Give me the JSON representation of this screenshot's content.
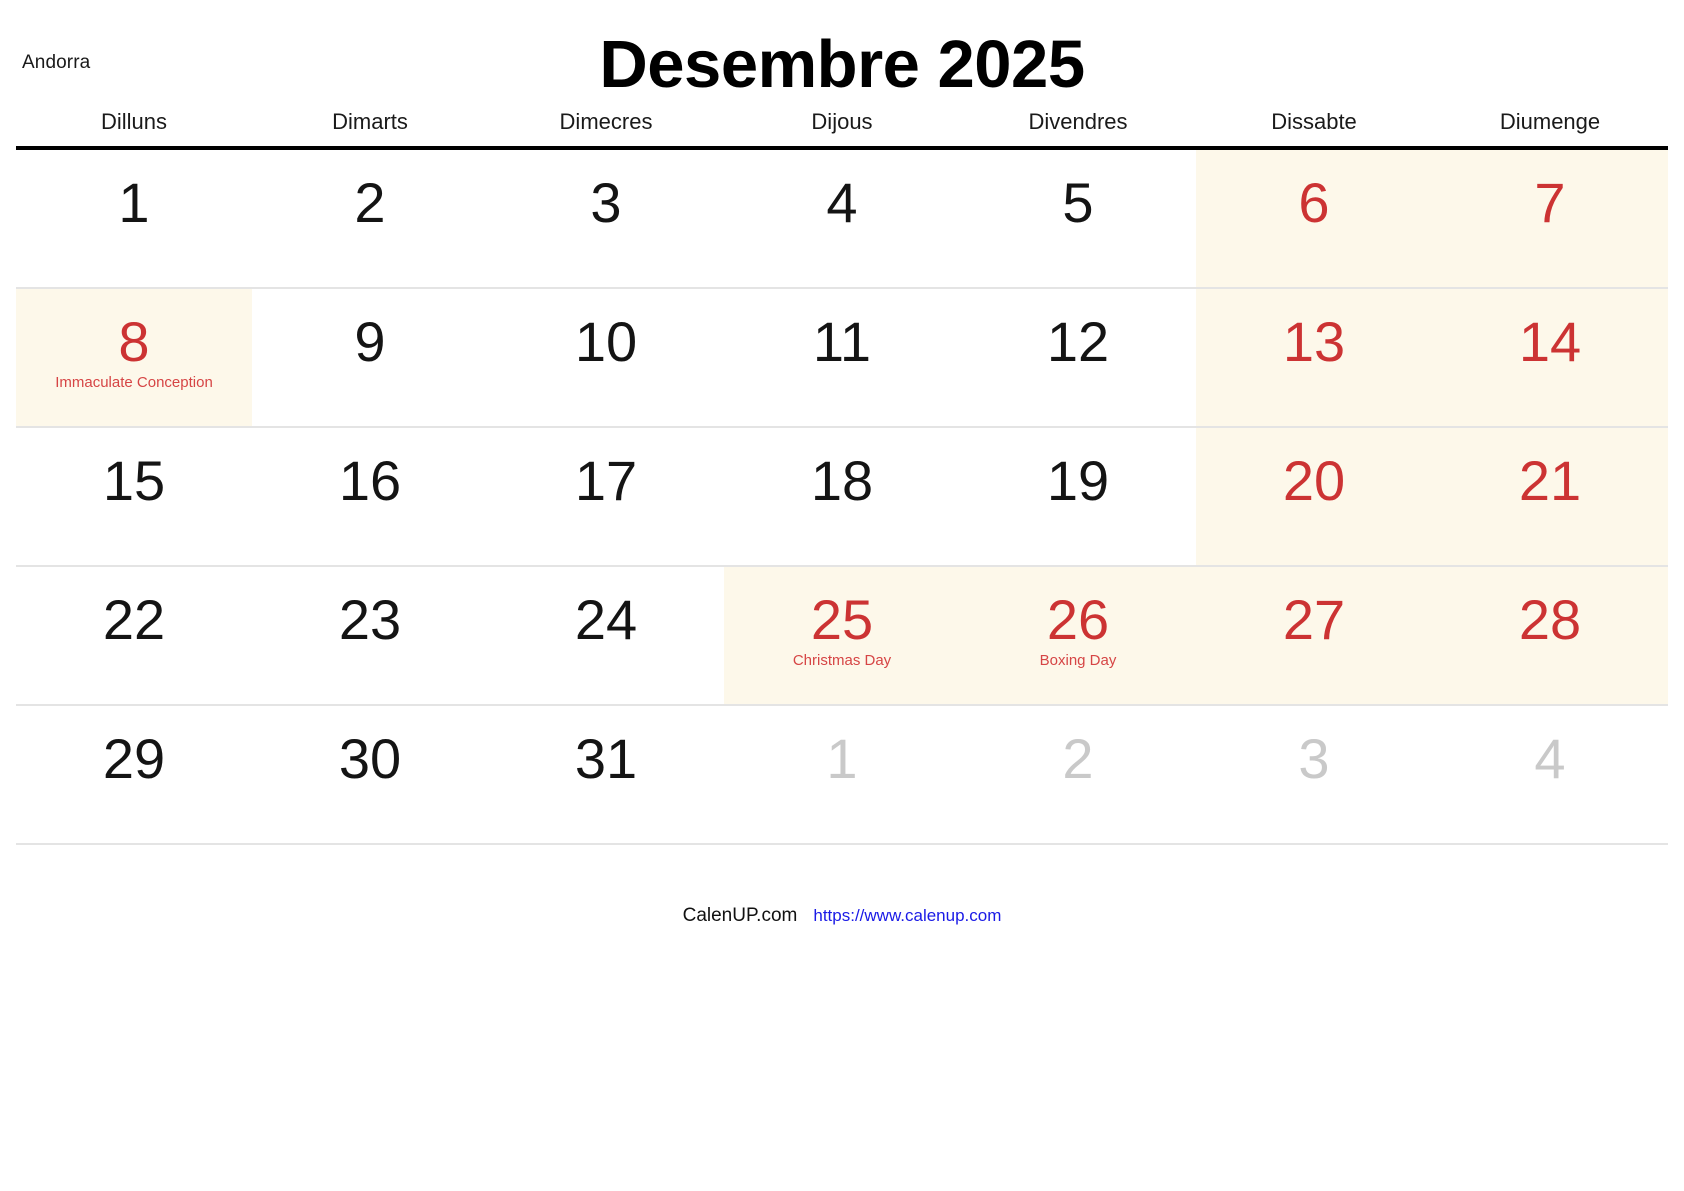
{
  "header": {
    "country": "Andorra",
    "title": "Desembre 2025"
  },
  "weekdays": [
    "Dilluns",
    "Dimarts",
    "Dimecres",
    "Dijous",
    "Divendres",
    "Dissabte",
    "Diumenge"
  ],
  "colors": {
    "holiday_red": "#cc3333",
    "holiday_tint": "#fdf8ea",
    "outside_grey": "#c9c9c9",
    "link_blue": "#1a1ae6",
    "rule_black": "#000000",
    "row_divider": "#e4e4e4"
  },
  "weeks": [
    [
      {
        "num": "1",
        "type": "normal"
      },
      {
        "num": "2",
        "type": "normal"
      },
      {
        "num": "3",
        "type": "normal"
      },
      {
        "num": "4",
        "type": "normal"
      },
      {
        "num": "5",
        "type": "normal"
      },
      {
        "num": "6",
        "type": "weekend",
        "tint": true
      },
      {
        "num": "7",
        "type": "weekend",
        "tint": true
      }
    ],
    [
      {
        "num": "8",
        "type": "holiday",
        "tint": true,
        "holiday": "Immaculate Conception"
      },
      {
        "num": "9",
        "type": "normal"
      },
      {
        "num": "10",
        "type": "normal"
      },
      {
        "num": "11",
        "type": "normal"
      },
      {
        "num": "12",
        "type": "normal"
      },
      {
        "num": "13",
        "type": "weekend",
        "tint": true
      },
      {
        "num": "14",
        "type": "weekend",
        "tint": true
      }
    ],
    [
      {
        "num": "15",
        "type": "normal"
      },
      {
        "num": "16",
        "type": "normal"
      },
      {
        "num": "17",
        "type": "normal"
      },
      {
        "num": "18",
        "type": "normal"
      },
      {
        "num": "19",
        "type": "normal"
      },
      {
        "num": "20",
        "type": "weekend",
        "tint": true
      },
      {
        "num": "21",
        "type": "weekend",
        "tint": true
      }
    ],
    [
      {
        "num": "22",
        "type": "normal"
      },
      {
        "num": "23",
        "type": "normal"
      },
      {
        "num": "24",
        "type": "normal"
      },
      {
        "num": "25",
        "type": "holiday",
        "tint": true,
        "holiday": "Christmas Day"
      },
      {
        "num": "26",
        "type": "holiday",
        "tint": true,
        "holiday": "Boxing Day"
      },
      {
        "num": "27",
        "type": "weekend",
        "tint": true
      },
      {
        "num": "28",
        "type": "weekend",
        "tint": true
      }
    ],
    [
      {
        "num": "29",
        "type": "normal"
      },
      {
        "num": "30",
        "type": "normal"
      },
      {
        "num": "31",
        "type": "normal"
      },
      {
        "num": "1",
        "type": "outside"
      },
      {
        "num": "2",
        "type": "outside"
      },
      {
        "num": "3",
        "type": "outside"
      },
      {
        "num": "4",
        "type": "outside"
      }
    ]
  ],
  "footer": {
    "brand": "CalenUP.com",
    "url": "https://www.calenup.com"
  }
}
